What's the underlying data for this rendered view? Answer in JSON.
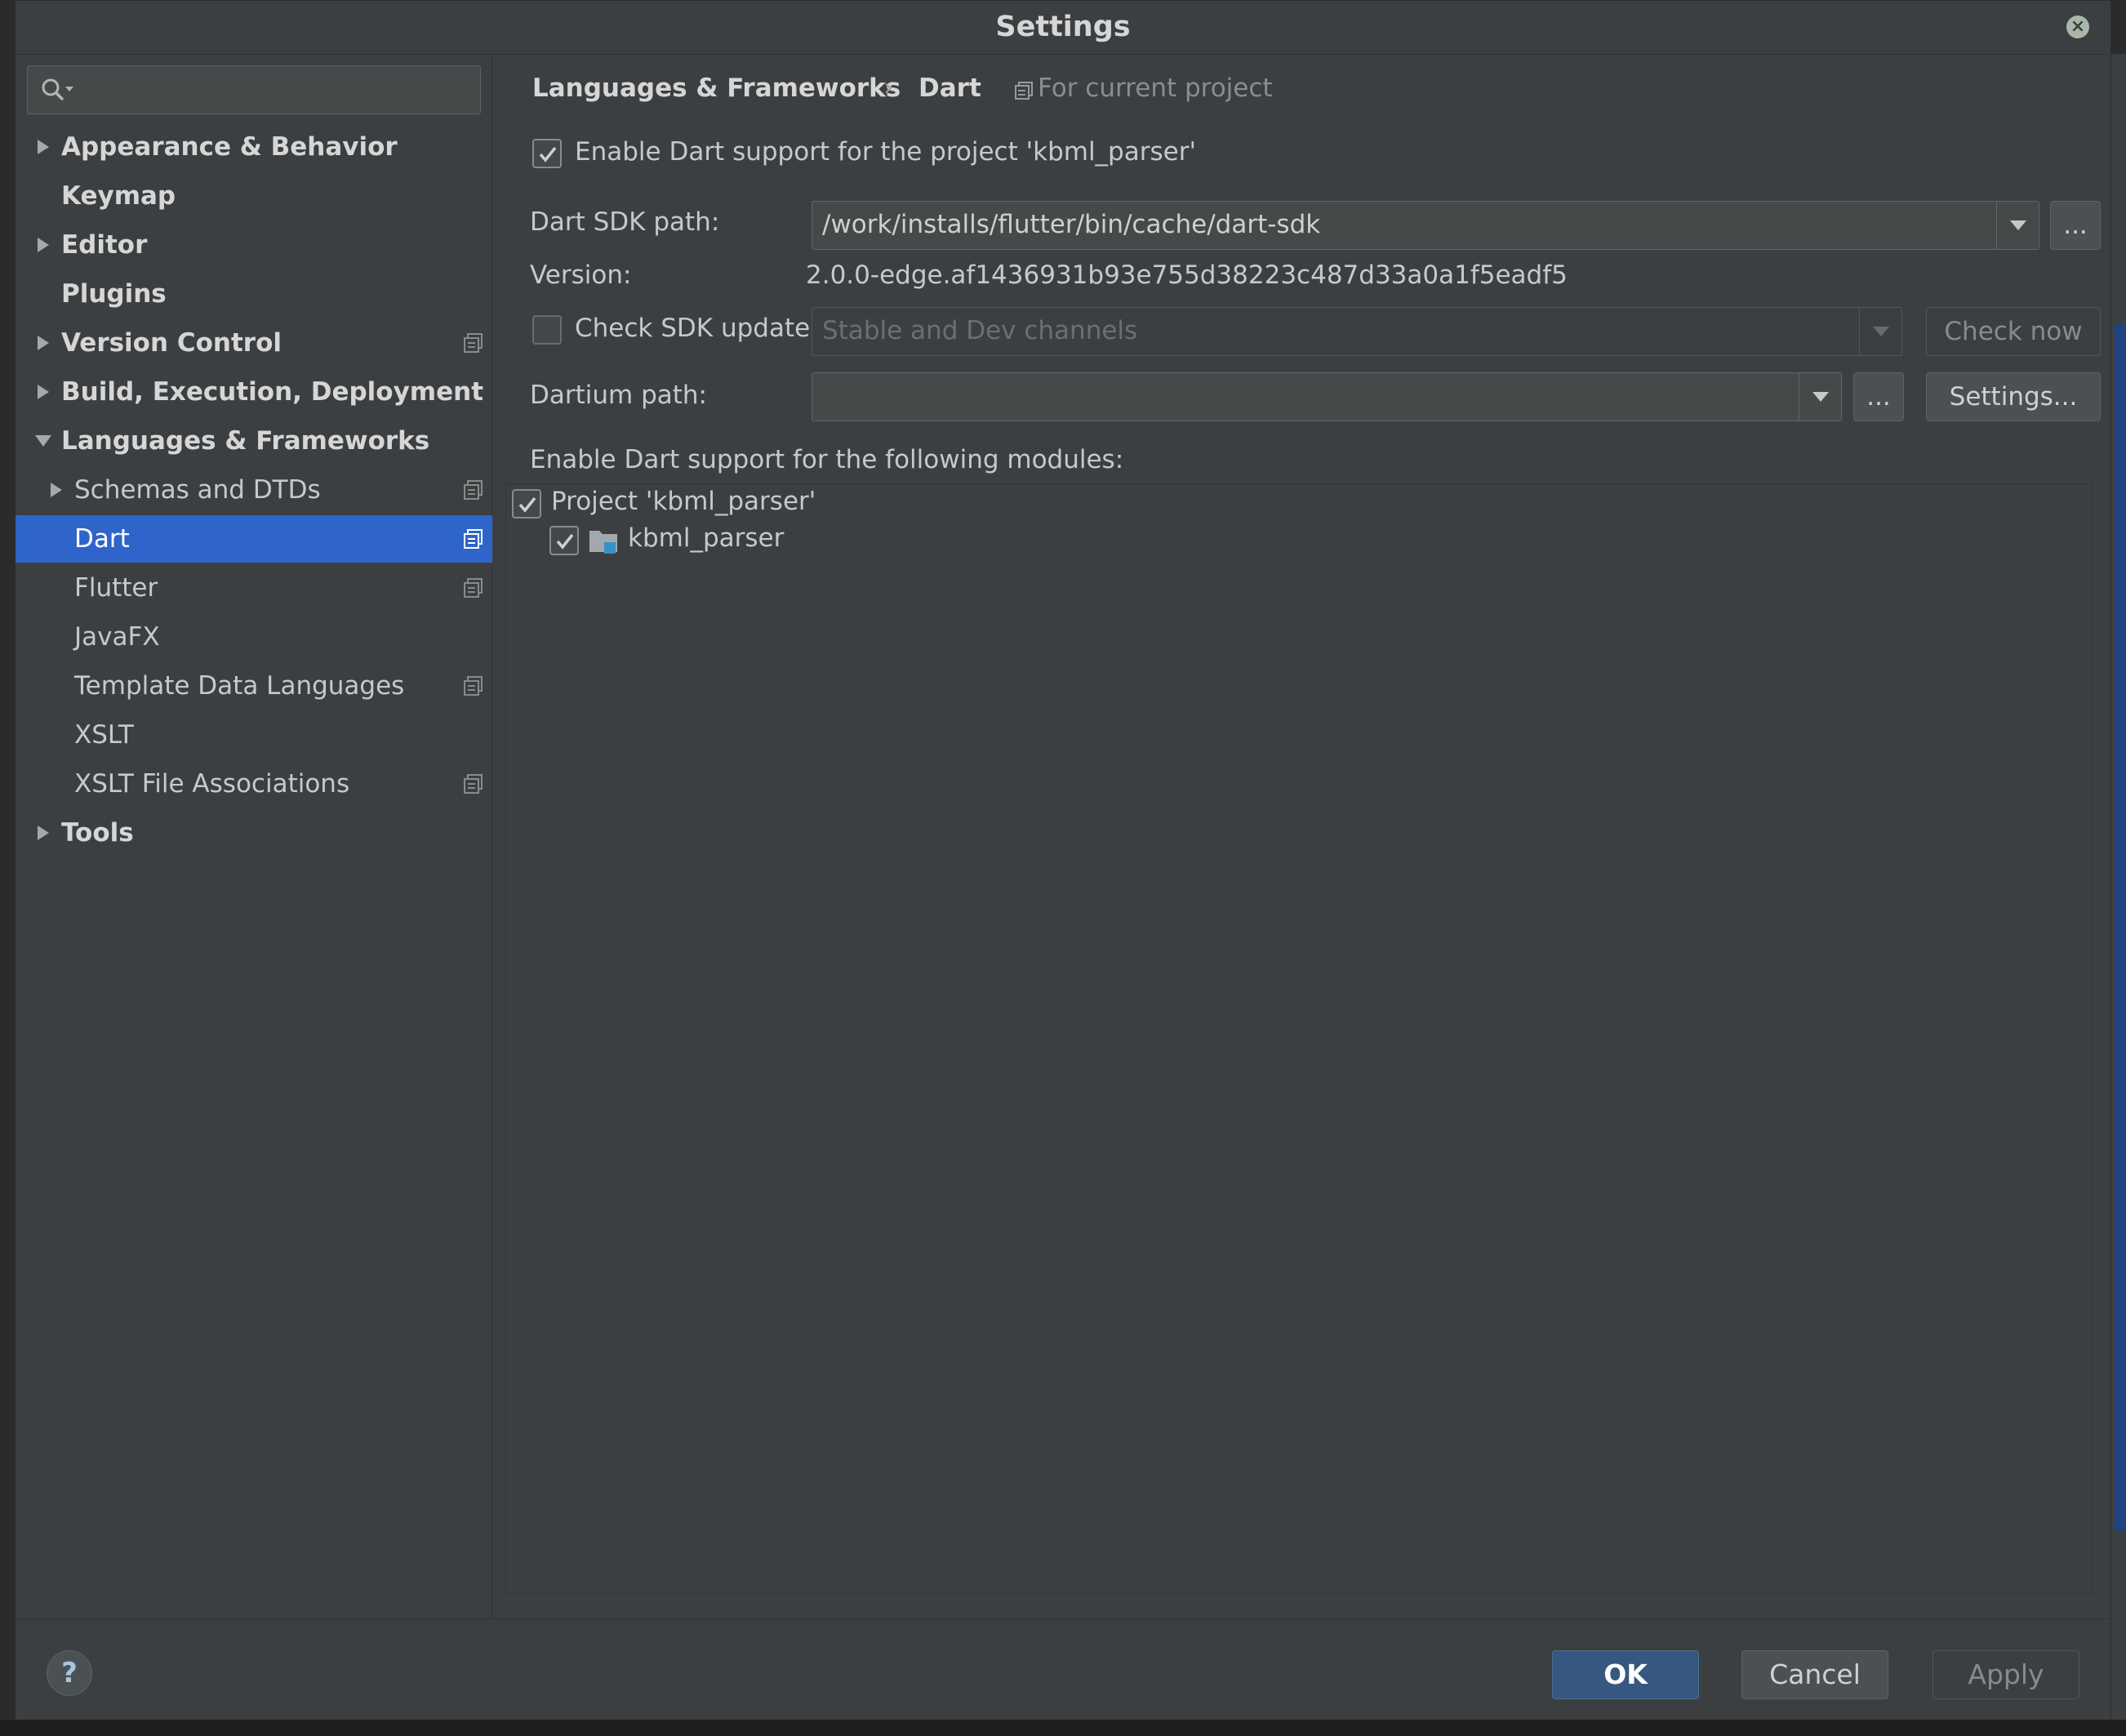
{
  "window": {
    "title": "Settings"
  },
  "sidebar": {
    "search_placeholder": "",
    "items": [
      {
        "label": "Appearance & Behavior",
        "bold": true,
        "expandable": true,
        "expanded": false
      },
      {
        "label": "Keymap",
        "bold": true
      },
      {
        "label": "Editor",
        "bold": true,
        "expandable": true,
        "expanded": false
      },
      {
        "label": "Plugins",
        "bold": true
      },
      {
        "label": "Version Control",
        "bold": true,
        "expandable": true,
        "expanded": false,
        "project_icon": true
      },
      {
        "label": "Build, Execution, Deployment",
        "bold": true,
        "expandable": true,
        "expanded": false
      },
      {
        "label": "Languages & Frameworks",
        "bold": true,
        "expandable": true,
        "expanded": true
      },
      {
        "label": "Schemas and DTDs",
        "expandable": true,
        "expanded": false,
        "project_icon": true
      },
      {
        "label": "Dart",
        "selected": true,
        "project_icon": true
      },
      {
        "label": "Flutter",
        "project_icon": true
      },
      {
        "label": "JavaFX"
      },
      {
        "label": "Template Data Languages",
        "project_icon": true
      },
      {
        "label": "XSLT"
      },
      {
        "label": "XSLT File Associations",
        "project_icon": true
      },
      {
        "label": "Tools",
        "bold": true,
        "expandable": true,
        "expanded": false
      }
    ]
  },
  "breadcrumb": {
    "parent": "Languages & Frameworks",
    "current": "Dart",
    "scope": "For current project"
  },
  "dart": {
    "enable_label": "Enable Dart support for the project 'kbml_parser'",
    "enable_checked": true,
    "sdk_path_label": "Dart SDK path:",
    "sdk_path_value": "/work/installs/flutter/bin/cache/dart-sdk",
    "browse_label": "...",
    "version_label": "Version:",
    "version_value": "2.0.0-edge.af1436931b93e755d38223c487d33a0a1f5eadf5",
    "check_update_label": "Check SDK update:",
    "check_update_checked": false,
    "channel_value": "Stable and Dev channels",
    "check_now_label": "Check now",
    "dartium_label": "Dartium path:",
    "dartium_value": "",
    "dartium_browse_label": "...",
    "settings_label": "Settings...",
    "modules_label": "Enable Dart support for the following modules:",
    "modules": [
      {
        "label": "Project 'kbml_parser'",
        "checked": true
      },
      {
        "label": "kbml_parser",
        "checked": true
      }
    ]
  },
  "footer": {
    "help_label": "?",
    "ok_label": "OK",
    "cancel_label": "Cancel",
    "apply_label": "Apply"
  },
  "colors": {
    "selection": "#2f65ca",
    "dialog_bg": "#3c3f41",
    "primary_button": "#365880"
  }
}
